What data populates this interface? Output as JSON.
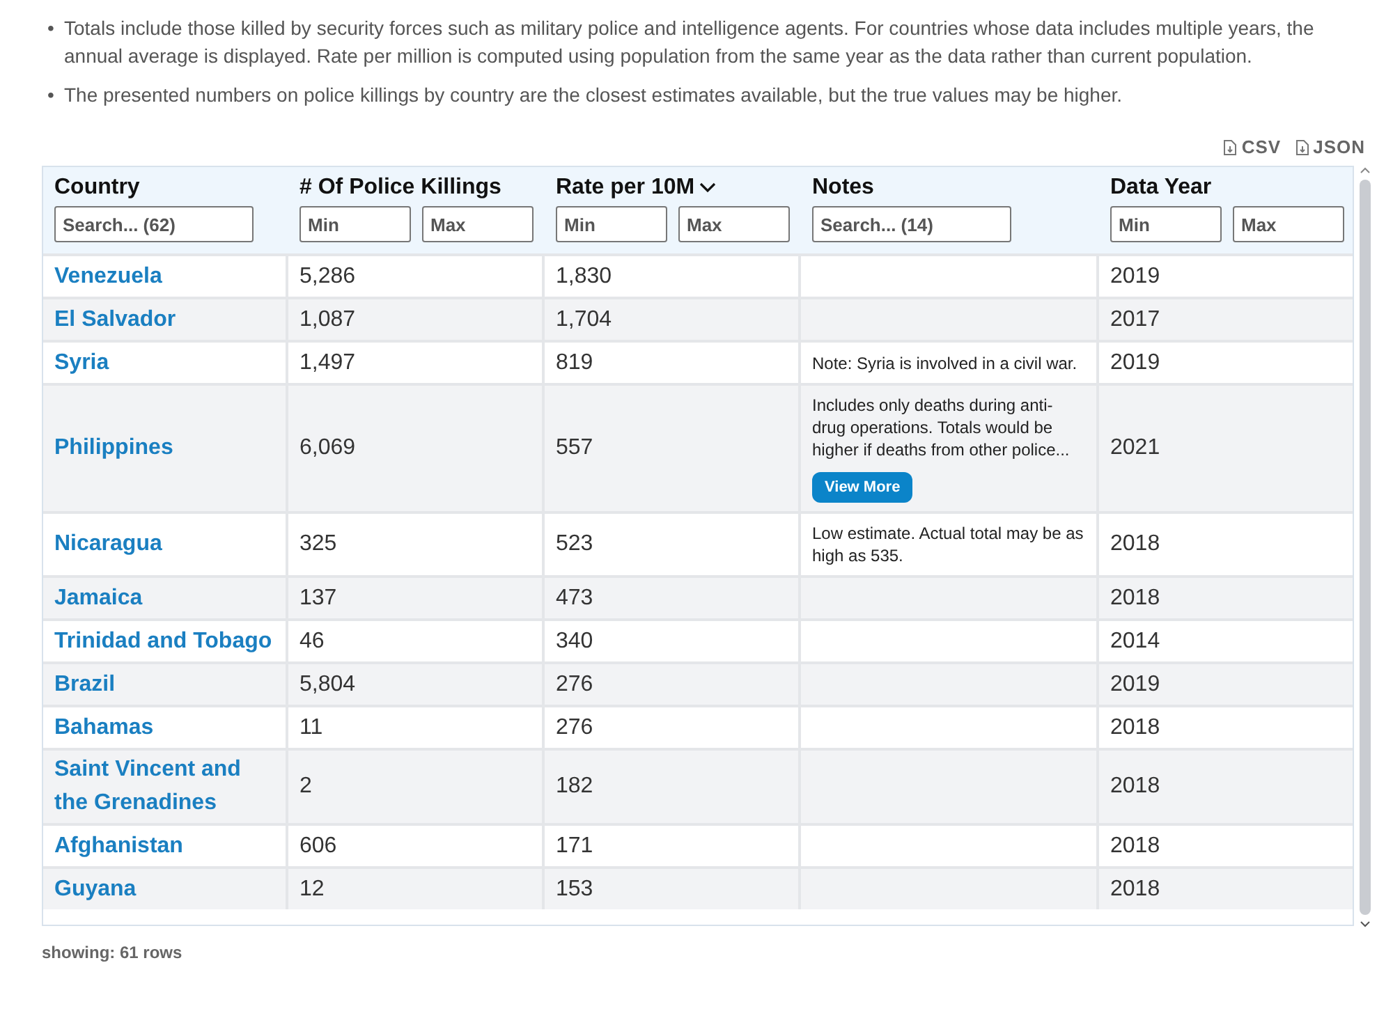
{
  "notes": [
    {
      "bullet": "•",
      "text": "Totals include those killed by security forces such as military police and intelligence agents. For countries whose data includes multiple years, the annual average is displayed. Rate per million is computed using population from the same year as the data rather than current population."
    },
    {
      "bullet": "•",
      "text": "The presented numbers on police killings by country are the closest estimates available, but the true values may be higher."
    }
  ],
  "downloads": [
    "CSV",
    "JSON"
  ],
  "columns": [
    {
      "label": "Country",
      "sorted": false,
      "filters": [
        {
          "placeholder": "Search... (62)"
        }
      ]
    },
    {
      "label": "# Of Police Killings",
      "sorted": false,
      "filters": [
        {
          "placeholder": "Min"
        },
        {
          "placeholder": "Max"
        }
      ]
    },
    {
      "label": "Rate per 10M",
      "sorted": true,
      "filters": [
        {
          "placeholder": "Min"
        },
        {
          "placeholder": "Max"
        }
      ]
    },
    {
      "label": "Notes",
      "sorted": false,
      "filters": [
        {
          "placeholder": "Search... (14)"
        }
      ]
    },
    {
      "label": "Data Year",
      "sorted": false,
      "filters": [
        {
          "placeholder": "Min"
        },
        {
          "placeholder": "Max"
        }
      ]
    }
  ],
  "rows": [
    {
      "country": "Venezuela",
      "killings": "5,286",
      "rate": "1,830",
      "year": "2019"
    },
    {
      "country": "El Salvador",
      "killings": "1,087",
      "rate": "1,704",
      "year": "2017"
    },
    {
      "country": "Syria",
      "killings": "1,497",
      "rate": "819",
      "note": "Note: Syria is involved in a civil war.",
      "year": "2019"
    },
    {
      "country": "Philippines",
      "killings": "6,069",
      "rate": "557",
      "note": "Includes only deaths during anti-drug operations. Totals would be higher if deaths from other police...",
      "more": "View More",
      "year": "2021"
    },
    {
      "country": "Nicaragua",
      "killings": "325",
      "rate": "523",
      "note": "Low estimate. Actual total may be as high as 535.",
      "year": "2018"
    },
    {
      "country": "Jamaica",
      "killings": "137",
      "rate": "473",
      "year": "2018"
    },
    {
      "country": "Trinidad and Tobago",
      "killings": "46",
      "rate": "340",
      "year": "2014"
    },
    {
      "country": "Brazil",
      "killings": "5,804",
      "rate": "276",
      "year": "2019"
    },
    {
      "country": "Bahamas",
      "killings": "11",
      "rate": "276",
      "year": "2018"
    },
    {
      "country": "Saint Vincent and the Grenadines",
      "killings": "2",
      "rate": "182",
      "year": "2018"
    },
    {
      "country": "Afghanistan",
      "killings": "606",
      "rate": "171",
      "year": "2018"
    },
    {
      "country": "Guyana",
      "killings": "12",
      "rate": "153",
      "year": "2018"
    }
  ],
  "footer": "showing: 61 rows"
}
